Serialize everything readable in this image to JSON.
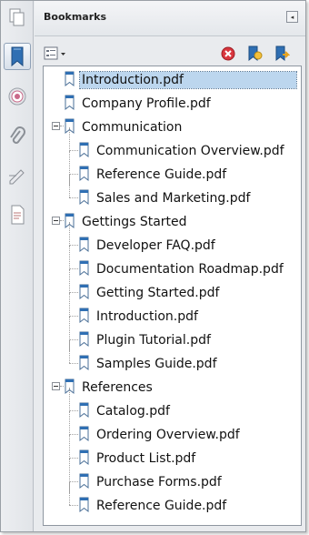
{
  "panel": {
    "title": "Bookmarks",
    "collapse_glyph": "◂"
  },
  "sidebar": {
    "items": [
      {
        "name": "pages-icon"
      },
      {
        "name": "bookmarks-icon",
        "active": true
      },
      {
        "name": "signatures-icon"
      },
      {
        "name": "attachments-icon"
      },
      {
        "name": "comments-icon"
      },
      {
        "name": "layers-icon"
      }
    ]
  },
  "toolbar": {
    "options_icon": "options-menu-icon",
    "delete_icon": "delete-bookmark-icon",
    "new_icon": "new-bookmark-icon",
    "expand_icon": "expand-bookmark-icon"
  },
  "tree": {
    "items": [
      {
        "label": "Introduction.pdf",
        "level": 0,
        "selected": true
      },
      {
        "label": "Company Profile.pdf",
        "level": 0
      },
      {
        "label": "Communication",
        "level": 0,
        "expanded": true
      },
      {
        "label": "Communication Overview.pdf",
        "level": 1
      },
      {
        "label": "Reference Guide.pdf",
        "level": 1
      },
      {
        "label": "Sales and Marketing.pdf",
        "level": 1
      },
      {
        "label": "Gettings Started",
        "level": 0,
        "expanded": true
      },
      {
        "label": "Developer FAQ.pdf",
        "level": 1
      },
      {
        "label": "Documentation Roadmap.pdf",
        "level": 1
      },
      {
        "label": "Getting Started.pdf",
        "level": 1
      },
      {
        "label": "Introduction.pdf",
        "level": 1
      },
      {
        "label": "Plugin Tutorial.pdf",
        "level": 1
      },
      {
        "label": "Samples Guide.pdf",
        "level": 1
      },
      {
        "label": "References",
        "level": 0,
        "expanded": true
      },
      {
        "label": "Catalog.pdf",
        "level": 1
      },
      {
        "label": "Ordering Overview.pdf",
        "level": 1
      },
      {
        "label": "Product List.pdf",
        "level": 1
      },
      {
        "label": "Purchase Forms.pdf",
        "level": 1
      },
      {
        "label": "Reference Guide.pdf",
        "level": 1
      }
    ]
  },
  "colors": {
    "selection": "#bcd6ee",
    "bookmark_icon": "#2f6fb3",
    "delete": "#d9363e"
  }
}
